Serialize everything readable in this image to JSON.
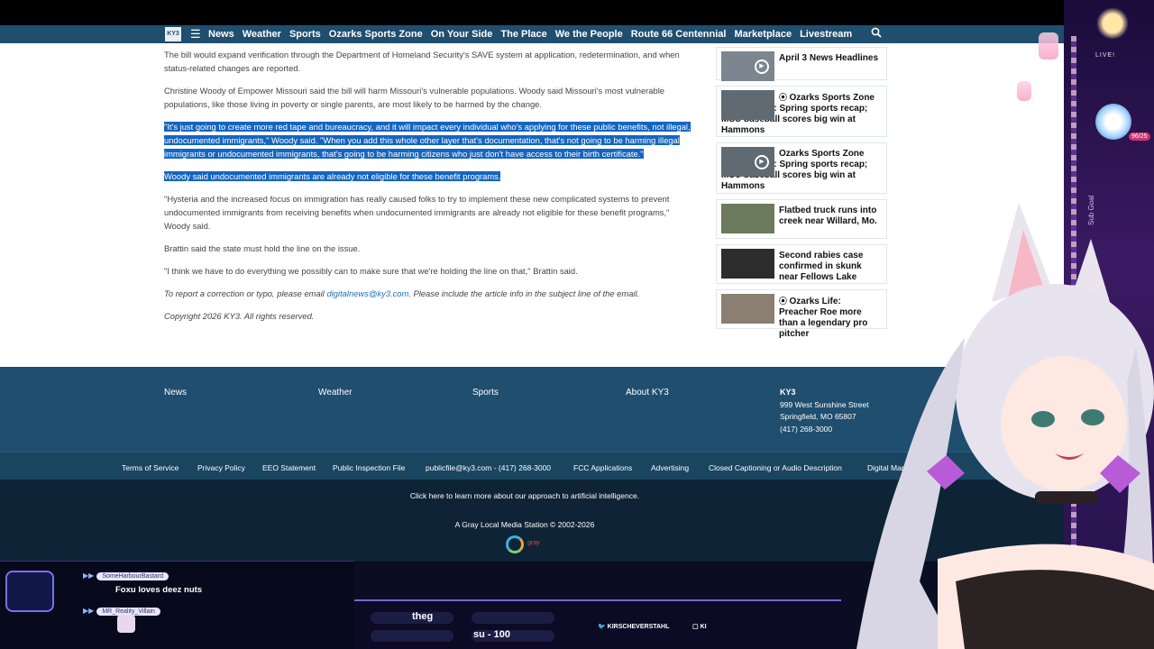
{
  "nav": {
    "logo": "KY3",
    "links": [
      "News",
      "Weather",
      "Sports",
      "Ozarks Sports Zone",
      "On Your Side",
      "The Place",
      "We the People",
      "Route 66 Centennial",
      "Marketplace",
      "Livestream"
    ]
  },
  "article": {
    "p1": "The bill would expand verification through the Department of Homeland Security's SAVE system at application, redetermination, and when status-related changes are reported.",
    "p2": "Christine Woody of Empower Missouri said the bill will harm Missouri's vulnerable populations. Woody said Missouri's most vulnerable populations, like those living in poverty or single parents, are most likely to be harmed by the change.",
    "p3": "\"It's just going to create more red tape and bureaucracy, and it will impact every individual who's applying for these public benefits, not illegal, undocumented immigrants,\" Woody said. \"When you add this whole other layer that's documentation, that's not going to be harming illegal immigrants or undocumented immigrants, that's going to be harming citizens who just don't have access to their birth certificate.\"",
    "p4": "Woody said undocumented immigrants are already not eligible for these benefit programs.",
    "p5": "\"Hysteria and the increased focus on immigration has really caused folks to try to implement these new complicated systems to prevent undocumented immigrants from receiving benefits when undocumented immigrants are already not eligible for these benefit programs,\" Woody said.",
    "p6": "Brattin said the state must hold the line on the issue.",
    "p7": "\"I think we have to do everything we possibly can to make sure that we're holding the line on that,\" Brattin said.",
    "p8_pre": "To report a correction or typo, please email ",
    "p8_link": "digitalnews@ky3.com",
    "p8_post": ". Please include the article info in the subject line of the email.",
    "copyright": "Copyright 2026 KY3. All rights reserved."
  },
  "sidebar": [
    {
      "title": "April 3 News Headlines"
    },
    {
      "title": "Ozarks Sports Zone Digital Extra: Spring sports recap; MSU baseball scores big win at Hammons"
    },
    {
      "title": "Ozarks Sports Zone Digital Extra: Spring sports recap; MSU baseball scores big win at Hammons"
    },
    {
      "title": "Flatbed truck runs into creek near Willard, Mo."
    },
    {
      "title": "Second rabies case confirmed in skunk near Fellows Lake"
    },
    {
      "title": "Ozarks Life: Preacher Roe more than a legendary pro pitcher"
    }
  ],
  "footer": {
    "links": [
      "News",
      "Weather",
      "Sports",
      "About KY3"
    ],
    "station": "KY3",
    "street": "999 West Sunshine Street",
    "city": "Springfield, MO 65807",
    "phone": "(417) 268-3000",
    "legal": [
      "Terms of Service",
      "Privacy Policy",
      "EEO Statement",
      "Public Inspection File",
      "publicfile@ky3.com - (417) 268-3000",
      "FCC Applications",
      "Advertising",
      "Closed Captioning or Audio Description",
      "Digital Marketing"
    ],
    "ai_note": "Click here to learn more about our approach to artificial intelligence.",
    "gray": "A Gray Local Media Station © 2002-2026",
    "gray_logo": "gray"
  },
  "stream": {
    "live": "LIVE!",
    "count": "96/25",
    "goal": "Sub Goal",
    "chat": [
      {
        "user": "SomeHarbourBastard",
        "text": "Foxu loves deez nuts"
      },
      {
        "user": "MR_Reality_Villain",
        "text": ""
      }
    ],
    "pill1": "theg",
    "pill2": "su - 100",
    "twitter": "KIRSCHEVERSTAHL",
    "other": "KI"
  }
}
